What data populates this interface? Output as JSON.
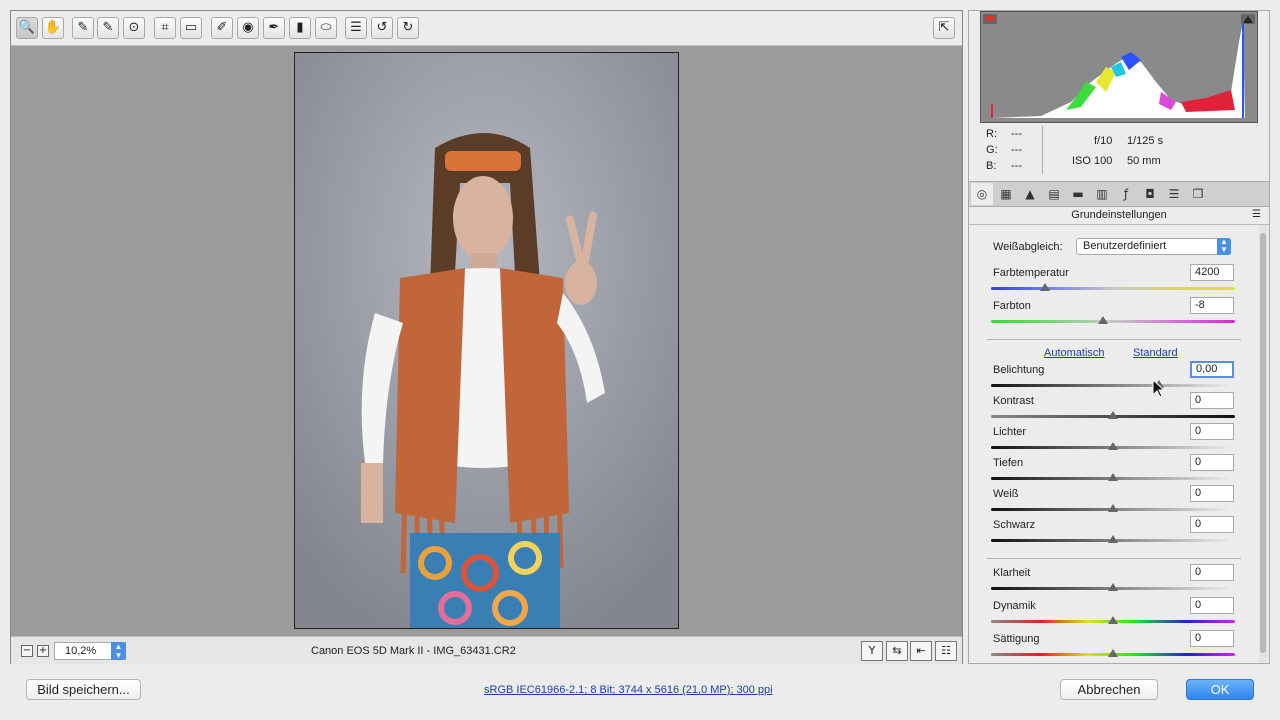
{
  "toolbar": {
    "tools": [
      {
        "name": "zoom-tool",
        "icon": "🔍"
      },
      {
        "name": "hand-tool",
        "icon": "✋"
      },
      {
        "name": "white-balance-tool",
        "icon": "✎"
      },
      {
        "name": "color-sampler-tool",
        "icon": "✎"
      },
      {
        "name": "targeted-adjustment-tool",
        "icon": "⊙"
      },
      {
        "name": "crop-tool",
        "icon": "⌗"
      },
      {
        "name": "straighten-tool",
        "icon": "▭"
      },
      {
        "name": "spot-removal-tool",
        "icon": "✐"
      },
      {
        "name": "red-eye-tool",
        "icon": "◉"
      },
      {
        "name": "adjustment-brush-tool",
        "icon": "✒"
      },
      {
        "name": "graduated-filter-tool",
        "icon": "▮"
      },
      {
        "name": "radial-filter-tool",
        "icon": "⬭"
      },
      {
        "name": "preferences-tool",
        "icon": "☰"
      },
      {
        "name": "rotate-left-tool",
        "icon": "↺"
      },
      {
        "name": "rotate-right-tool",
        "icon": "↻"
      }
    ],
    "fullscreen_icon": "⇱"
  },
  "status": {
    "zoom": "10,2%",
    "filename": "Canon EOS 5D Mark II - IMG_63431.CR2"
  },
  "camera": {
    "r_label": "R:",
    "r_value": "---",
    "g_label": "G:",
    "g_value": "---",
    "b_label": "B:",
    "b_value": "---",
    "aperture": "f/10",
    "shutter": "1/125 s",
    "iso": "ISO 100",
    "focal": "50 mm"
  },
  "panel": {
    "title": "Grundeinstellungen",
    "wb_label": "Weißabgleich:",
    "wb_value": "Benutzerdefiniert",
    "auto_link": "Automatisch",
    "standard_link": "Standard",
    "sliders": [
      {
        "label": "Farbtemperatur",
        "value": "4200",
        "pos": 0.22
      },
      {
        "label": "Farbton",
        "value": "-8",
        "pos": 0.46
      },
      {
        "label": "Belichtung",
        "value": "0,00",
        "pos": 0.69
      },
      {
        "label": "Kontrast",
        "value": "0",
        "pos": 0.5
      },
      {
        "label": "Lichter",
        "value": "0",
        "pos": 0.5
      },
      {
        "label": "Tiefen",
        "value": "0",
        "pos": 0.5
      },
      {
        "label": "Weiß",
        "value": "0",
        "pos": 0.5
      },
      {
        "label": "Schwarz",
        "value": "0",
        "pos": 0.5
      },
      {
        "label": "Klarheit",
        "value": "0",
        "pos": 0.5
      },
      {
        "label": "Dynamik",
        "value": "0",
        "pos": 0.5
      },
      {
        "label": "Sättigung",
        "value": "0",
        "pos": 0.5
      }
    ]
  },
  "footer": {
    "save_label": "Bild speichern...",
    "workflow": "sRGB IEC61966-2.1; 8 Bit; 3744 x 5616 (21,0 MP); 300 ppi",
    "cancel_label": "Abbrechen",
    "ok_label": "OK"
  },
  "colors": {
    "accent": "#3b8ff5",
    "link": "#1d3fa8"
  }
}
